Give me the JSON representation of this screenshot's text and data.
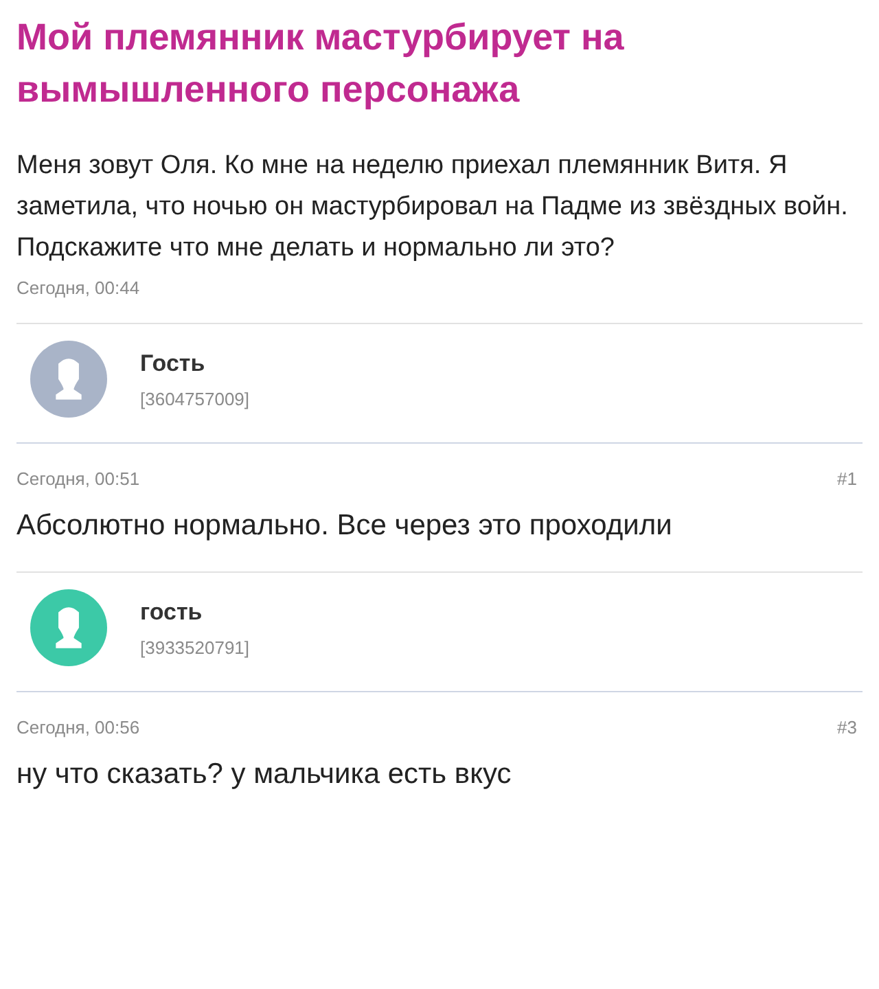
{
  "question": {
    "title": "Мой племянник мастурбирует на вымышленного персонажа",
    "body": "Меня зовут Оля. Ко мне на неделю приехал племянник Витя. Я заметила, что ночью он мастурбировал на Падме из звёздных войн. Подскажите что мне делать и нормально ли это?",
    "date": "Сегодня, 00:44"
  },
  "answers": [
    {
      "author": "Гость",
      "user_id": "[3604757009]",
      "color": "#a9b4c8",
      "date": "Сегодня, 00:51",
      "number": "#1",
      "text": "Абсолютно нормально. Все через это проходили"
    },
    {
      "author": "гость",
      "user_id": "[3933520791]",
      "color": "#3cc9a7",
      "date": "Сегодня, 00:56",
      "number": "#3",
      "text": "ну что сказать? у мальчика есть вкус"
    }
  ]
}
